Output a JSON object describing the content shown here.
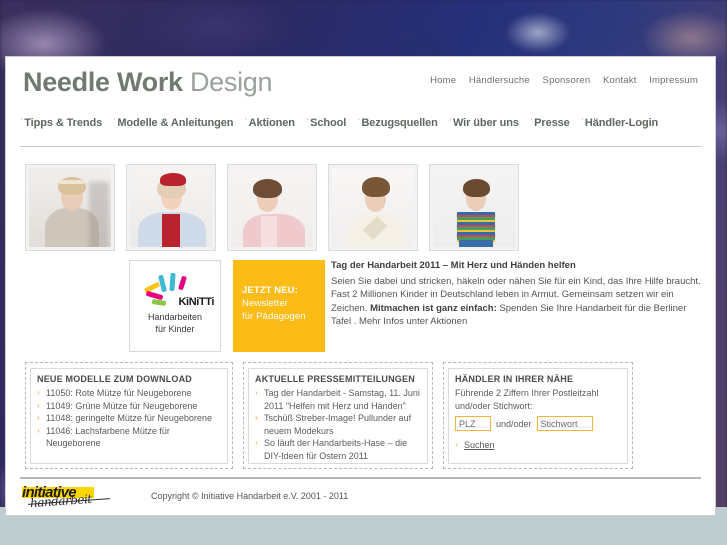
{
  "site": {
    "brand_bold": "Needle Work",
    "brand_light": "Design"
  },
  "top_nav": {
    "items": [
      {
        "label": "Home"
      },
      {
        "label": "Händlersuche"
      },
      {
        "label": "Sponsoren"
      },
      {
        "label": "Kontakt"
      },
      {
        "label": "Impressum"
      }
    ]
  },
  "main_nav": {
    "bullet": "ˈ",
    "items": [
      {
        "label": "Tipps & Trends"
      },
      {
        "label": "Modelle & Anleitungen"
      },
      {
        "label": "Aktionen"
      },
      {
        "label": "School"
      },
      {
        "label": "Bezugsquellen"
      },
      {
        "label": "Wir über uns"
      },
      {
        "label": "Presse"
      },
      {
        "label": "Händler-Login"
      }
    ]
  },
  "gallery": {
    "items": [
      {
        "alt": "Modell im grauen Strickkleid mit Haarband"
      },
      {
        "alt": "Modell mit roter Mütze und hellblauer Strickjacke"
      },
      {
        "alt": "Modell in rosa geblümter Bluse"
      },
      {
        "alt": "Modell in weißer Strickweste"
      },
      {
        "alt": "Modell in buntem Streifentop"
      }
    ]
  },
  "promo": {
    "kinitti": {
      "wordmark": "KiNiTTi",
      "caption_line1": "Handarbeiten",
      "caption_line2": "für Kinder",
      "dash_colors": [
        "#f5c518",
        "#3fb8d4",
        "#e6007e",
        "#8cc63f",
        "#e6007e",
        "#3fb8d4"
      ]
    },
    "newsletter": {
      "bg_color": "#fcbc18",
      "line1": "JETZT NEU:",
      "line2": "Newsletter",
      "line3": "für Pädagogen"
    },
    "article": {
      "title": "Tag der Handarbeit 2011 – Mit Herz und Händen helfen",
      "paragraph_part1": "Seien Sie dabei und stricken, häkeln oder nähen Sie für ein Kind, das Ihre Hilfe braucht. Fast 2 Millionen Kinder in Deutschland leben in Armut. Gemeinsam setzen wir ein Zeichen. ",
      "paragraph_bold": "Mitmachen ist ganz einfach:",
      "paragraph_part2": " Spenden Sie Ihre Handarbeit für die Berliner Tafel . Mehr Infos unter Aktionen"
    }
  },
  "boxes": {
    "models": {
      "title": "NEUE MODELLE ZUM DOWNLOAD",
      "items": [
        "11050: Rote Mütze für Neugeborene",
        "11049: Grüne Mütze für Neugeborene",
        "11048: geringelte Mütze für Neugeborene",
        "11046: Lachsfarbene Mütze für Neugeborene"
      ]
    },
    "press": {
      "title": "AKTUELLE PRESSEMITTEILUNGEN",
      "items": [
        "Tag der Handarbeit - Samstag, 11. Juni 2011 \"Helfen mit Herz und Händen\"",
        "Tschüß Streber-Image! Pullunder auf neuem Modekurs",
        "So läuft der Handarbeits-Hase – die DIY-Ideen für Ostern 2011"
      ]
    },
    "dealer": {
      "title": "HÄNDLER IN IHRER NÄHE",
      "description": "Führende 2 Ziffern Ihrer Postleitzahl und/oder Stichwort:",
      "plz_value": "PLZ",
      "andor_label": "und/oder",
      "keyword_value": "Stichwort",
      "search_label": "Suchen",
      "input_border_color": "#f0b53a"
    },
    "arrow_glyph": "›"
  },
  "footer": {
    "logo_word": "initiative",
    "logo_script": "handarbeit",
    "copyright": "Copyright © Initiative Handarbeit e.V. 2001 - 2011",
    "highlight_color": "#fdd600"
  }
}
